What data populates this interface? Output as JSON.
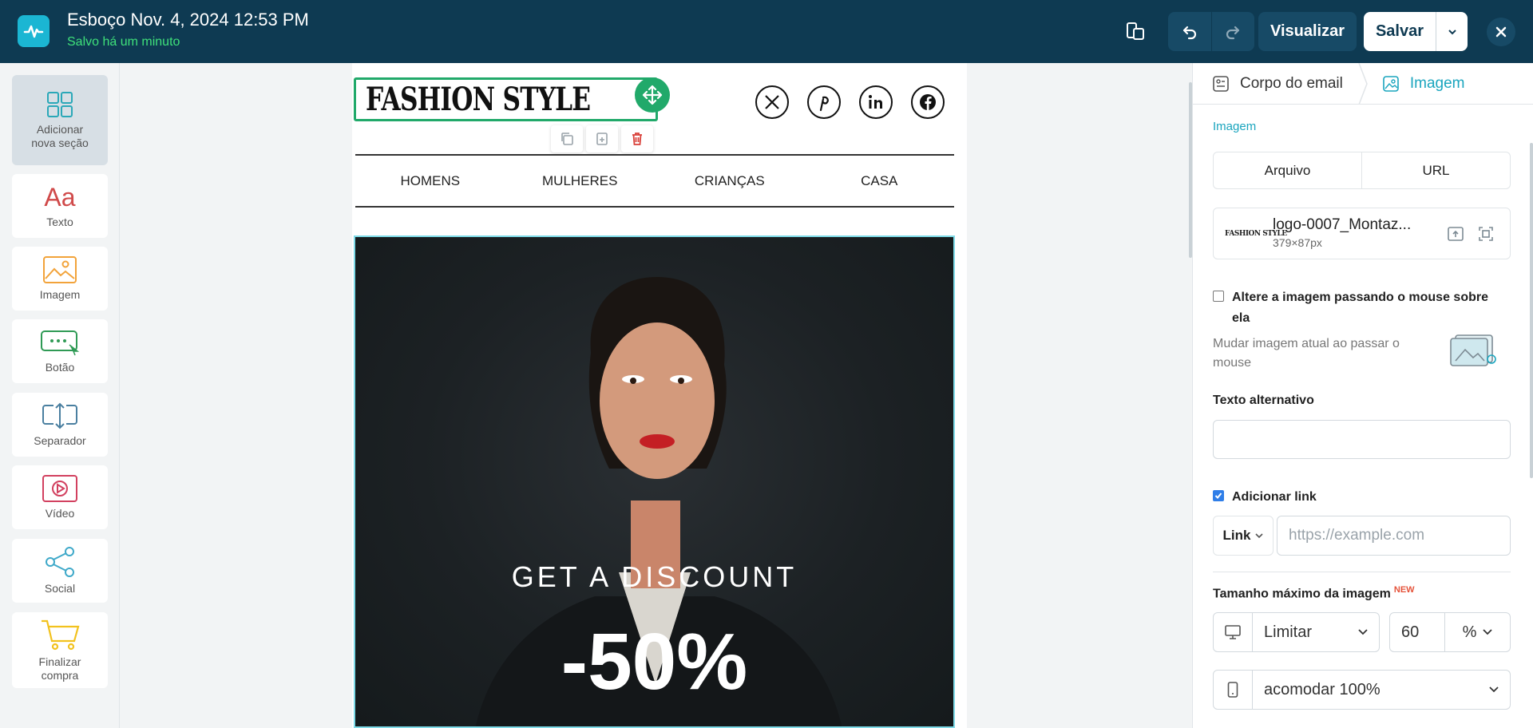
{
  "header": {
    "doc_title": "Esboço Nov. 4, 2024 12:53 PM",
    "saved_status": "Salvo há um minuto",
    "preview_label": "Visualizar",
    "save_label": "Salvar"
  },
  "sidebar": {
    "items": [
      {
        "label": "Adicionar nova seção"
      },
      {
        "label": "Texto"
      },
      {
        "label": "Imagem"
      },
      {
        "label": "Botão"
      },
      {
        "label": "Separador"
      },
      {
        "label": "Vídeo"
      },
      {
        "label": "Social"
      },
      {
        "label": "Finalizar compra"
      }
    ],
    "texto_icon_text": "Aa"
  },
  "email": {
    "logo_text": "FASHION STYLE",
    "nav": [
      "HOMENS",
      "MULHERES",
      "CRIANÇAS",
      "CASA"
    ],
    "hero_subtitle": "GET A DISCOUNT",
    "hero_discount": "-50%"
  },
  "panel": {
    "breadcrumb": [
      "Corpo do email",
      "Imagem"
    ],
    "section_label": "Imagem",
    "source_tabs": [
      "Arquivo",
      "URL"
    ],
    "file_thumb_text": "FASHION STYLE",
    "file_name": "logo-0007_Montaz...",
    "file_dims": "379×87px",
    "hover_checkbox_label": "Altere a imagem passando o mouse sobre ela",
    "hover_hint": "Mudar imagem atual ao passar o mouse",
    "alt_text_label": "Texto alternativo",
    "alt_text_value": "",
    "add_link_label": "Adicionar link",
    "add_link_checked": true,
    "link_type": "Link",
    "link_placeholder": "https://example.com",
    "max_size_label": "Tamanho máximo da imagem",
    "new_badge": "NEW",
    "desktop_mode": "Limitar",
    "desktop_value": "60",
    "desktop_unit": "%",
    "mobile_mode": "acomodar 100%"
  },
  "colors": {
    "topbar": "#0e3a52",
    "accent": "#1aa5be",
    "saved_green": "#3fe07a",
    "selection_green": "#21a96a"
  }
}
